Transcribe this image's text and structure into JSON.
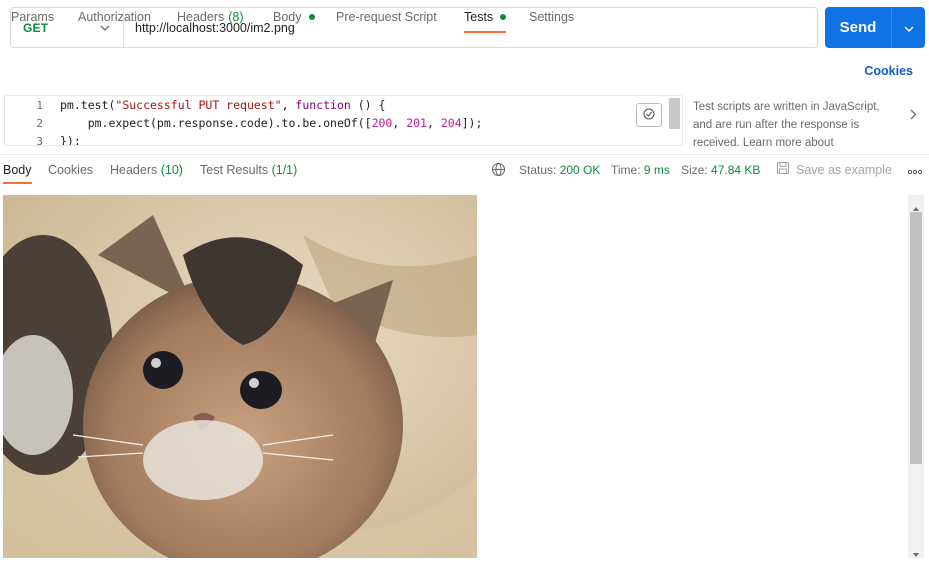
{
  "request": {
    "method": "GET",
    "url": "http://localhost:3000/im2.png",
    "send_label": "Send"
  },
  "req_tabs": {
    "params": "Params",
    "authorization": "Authorization",
    "headers": "Headers",
    "headers_count": "(8)",
    "body": "Body",
    "pre_request": "Pre-request Script",
    "tests": "Tests",
    "settings": "Settings",
    "cookies": "Cookies"
  },
  "editor": {
    "line_numbers": [
      "1",
      "2",
      "3"
    ],
    "line1_a": "pm.test(",
    "line1_str": "\"Successful PUT request\"",
    "line1_b": ", ",
    "line1_kw": "function",
    "line1_c": " () {",
    "line2_a": "    pm.expect(pm.response.code).to.be.oneOf([",
    "line2_n1": "200",
    "line2_sep1": ", ",
    "line2_n2": "201",
    "line2_sep2": ", ",
    "line2_n3": "204",
    "line2_b": "]);",
    "line3": "});"
  },
  "side_help": {
    "line1": "Test scripts are written in JavaScript,",
    "line2": "and are run after the response is",
    "line3": "received. Learn more about"
  },
  "response": {
    "tabs": {
      "body": "Body",
      "cookies": "Cookies",
      "headers": "Headers",
      "headers_count": "(10)",
      "test_results": "Test Results",
      "test_results_count": "(1/1)"
    },
    "status_label": "Status:",
    "status_value": "200 OK",
    "time_label": "Time:",
    "time_value": "9 ms",
    "size_label": "Size:",
    "size_value": "47.84 KB",
    "save_example": "Save as example"
  },
  "colors": {
    "accent": "#ff6c37",
    "send": "#0f73e6",
    "success": "#0f8a3b"
  },
  "icons": [
    "chevron-down-icon",
    "beautify-icon",
    "chevron-right-icon",
    "globe-icon",
    "save-icon",
    "more-icon"
  ]
}
